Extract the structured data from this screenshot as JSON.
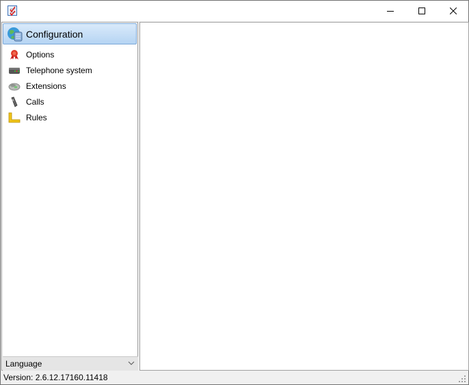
{
  "window": {
    "title": "",
    "app_icon": "checklist-icon",
    "controls": {
      "minimize": "minimize-icon",
      "maximize": "maximize-icon",
      "close": "close-icon"
    }
  },
  "sidebar": {
    "header": {
      "label": "Configuration",
      "icon": "globe-server-icon"
    },
    "items": [
      {
        "label": "Options",
        "icon": "ribbon-award-icon"
      },
      {
        "label": "Telephone system",
        "icon": "pbx-device-icon"
      },
      {
        "label": "Extensions",
        "icon": "desk-phone-icon"
      },
      {
        "label": "Calls",
        "icon": "mobile-phone-icon"
      },
      {
        "label": "Rules",
        "icon": "ruler-l-icon"
      }
    ],
    "language": {
      "label": "Language",
      "icon": "chevron-down-icon"
    }
  },
  "statusbar": {
    "version": "Version: 2.6.12.17160.11418"
  },
  "colors": {
    "header_gradient_top": "#d9eafb",
    "header_gradient_bottom": "#b5d4f3",
    "header_border": "#7aa7d8",
    "language_bg": "#e5e5e5",
    "window_bg": "#f0f0f0"
  }
}
